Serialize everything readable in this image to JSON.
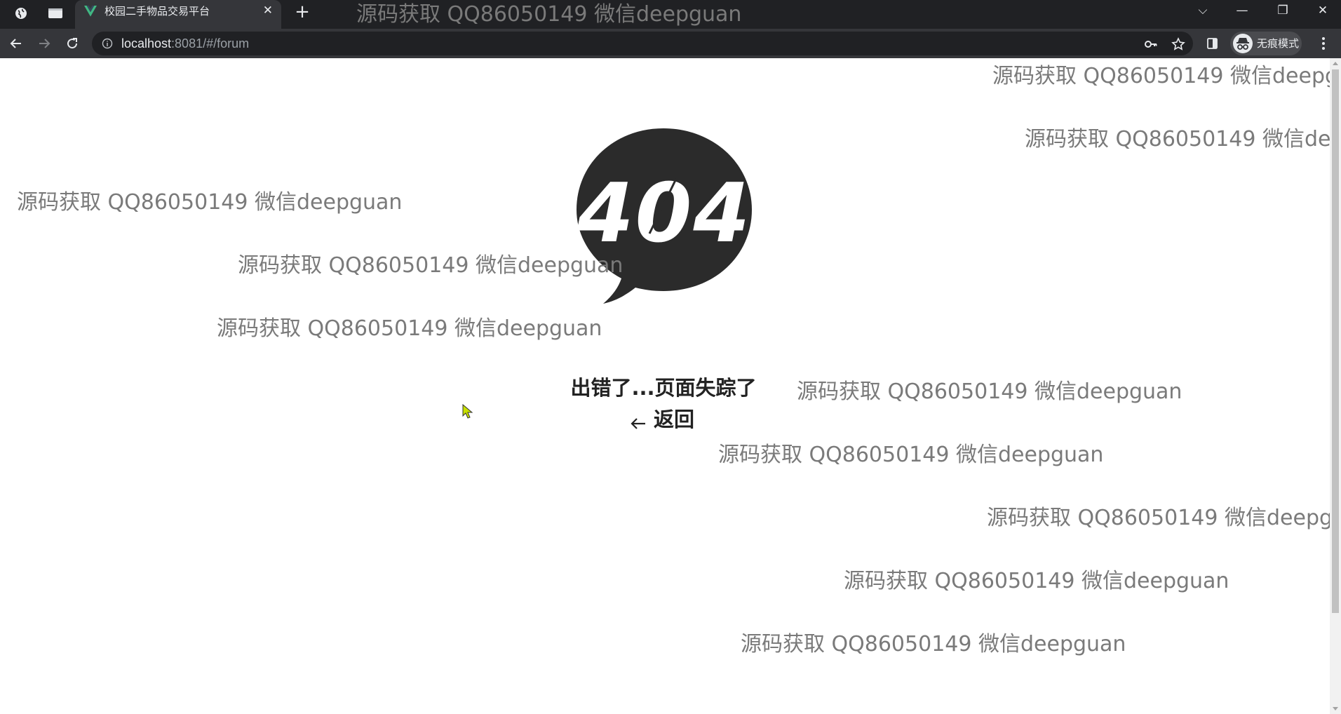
{
  "browser": {
    "tab": {
      "title": "校园二手物品交易平台",
      "close_glyph": "✕"
    },
    "new_tab_glyph": "+",
    "url": {
      "host": "localhost",
      "rest": ":8081/#/forum"
    },
    "profile": {
      "label": "无痕模式"
    },
    "window_controls": {
      "dropdown": "⌵",
      "minimize": "—",
      "restore": "❐",
      "close": "✕"
    }
  },
  "page": {
    "error_message": "出错了...页面失踪了",
    "back_label": "返回",
    "logo_text": "404"
  },
  "watermark_text": "源码获取 QQ86050149 微信deepguan"
}
